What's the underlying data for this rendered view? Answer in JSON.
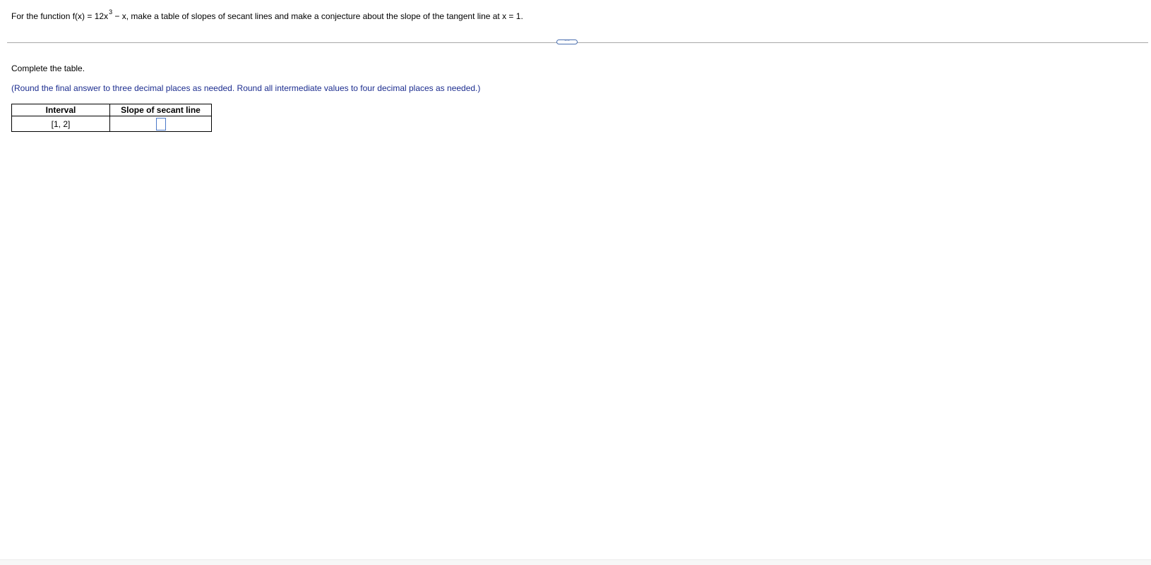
{
  "question": {
    "prefix": "For the function f(x) = 12x",
    "exponent": "3",
    "suffix": " − x, make a table of slopes of secant lines and make a conjecture about the slope of the tangent line at x = 1."
  },
  "expand_button": {
    "label": "···"
  },
  "instruction": "Complete the table.",
  "round_note": "(Round the final answer to three decimal places as needed. Round all intermediate values to four decimal places as needed.)",
  "table": {
    "headers": [
      "Interval",
      "Slope of secant line"
    ],
    "rows": [
      {
        "interval": "[1, 2]",
        "slope": ""
      }
    ]
  },
  "colors": {
    "note_text": "#1c2d8f",
    "answer_box_border": "#4a78c8",
    "divider": "#a8a8a8"
  }
}
